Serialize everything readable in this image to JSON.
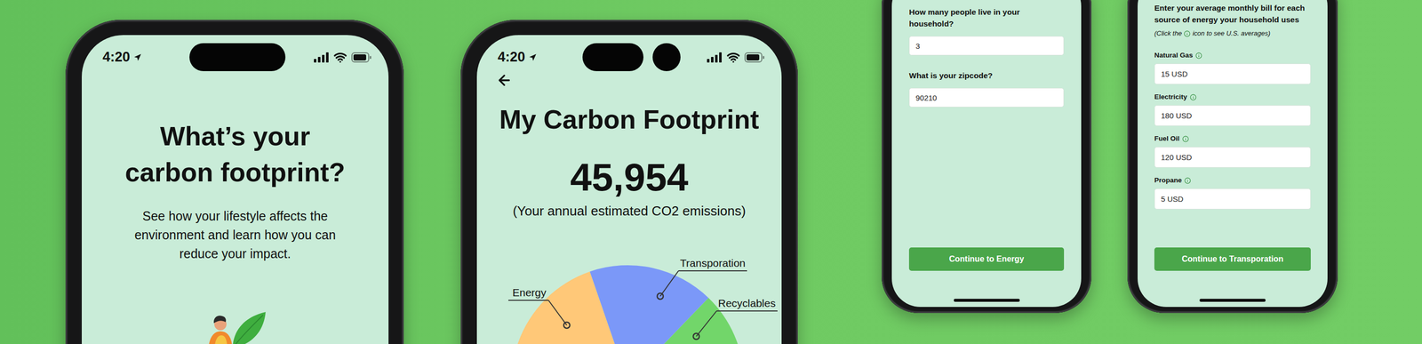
{
  "intro_screen": {
    "status_time": "4:20",
    "title": "What’s your carbon footprint?",
    "subtitle": "See how your lifestyle affects the environment and learn how you can reduce your impact."
  },
  "footprint_screen": {
    "status_time": "4:20",
    "title": "My Carbon Footprint",
    "total": "45,954",
    "caption": "(Your annual estimated CO2 emissions)",
    "chart": {
      "series": [
        {
          "label": "Energy",
          "value": 57.5,
          "color": "#ffc878"
        },
        {
          "label": "Transporation",
          "value": 17.5,
          "color": "#7b98f8"
        },
        {
          "label": "Recyclables",
          "value": 25,
          "color": "#72d66a"
        }
      ]
    }
  },
  "household_screen": {
    "fields": [
      {
        "label": "How many people live in your household?",
        "value": "3"
      },
      {
        "label": "What is your zipcode?",
        "value": "90210"
      }
    ],
    "button": "Continue to Energy"
  },
  "energy_screen": {
    "heading": "Enter your average monthly bill for each source of energy your household uses",
    "note_prefix": "(Click the",
    "note_suffix": "icon to see U.S. averages)",
    "fields": [
      {
        "label": "Natural Gas",
        "value": "15 USD"
      },
      {
        "label": "Electricity",
        "value": "180 USD"
      },
      {
        "label": "Fuel Oil",
        "value": "120 USD"
      },
      {
        "label": "Propane",
        "value": "5 USD"
      }
    ],
    "button": "Continue to Transporation"
  }
}
